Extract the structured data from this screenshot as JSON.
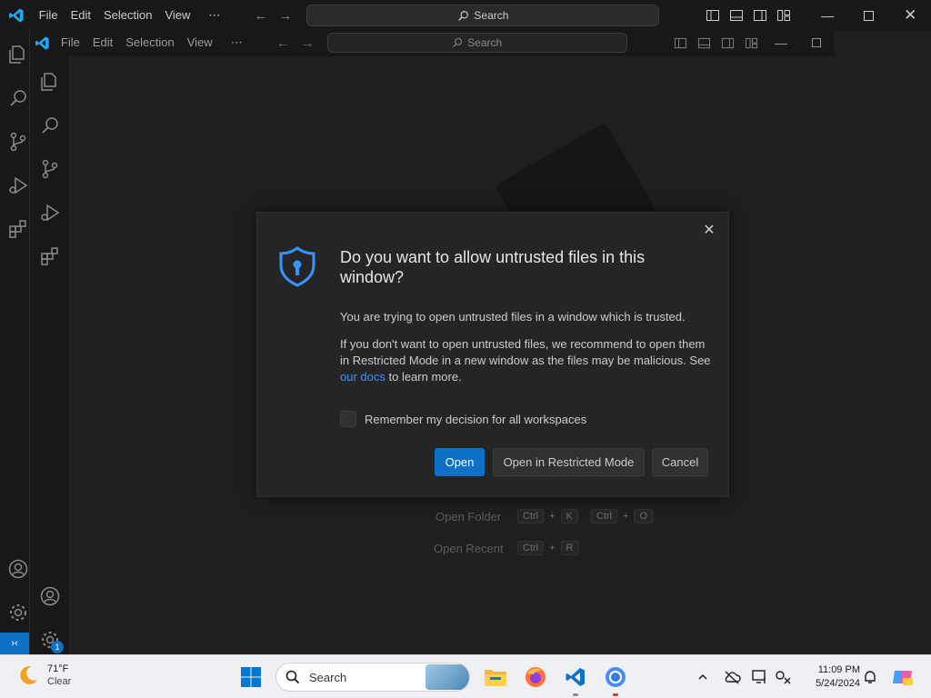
{
  "back_window": {
    "menu": [
      "File",
      "Edit",
      "Selection",
      "View",
      "⋯"
    ],
    "search_label": "Search"
  },
  "front_window": {
    "menu": [
      "File",
      "Edit",
      "Selection",
      "View",
      "⋯"
    ],
    "search_label": "Search"
  },
  "background_hints": {
    "open_folder": {
      "label": "Open Folder",
      "keys1": [
        "Ctrl",
        "K"
      ],
      "keys2": [
        "Ctrl",
        "O"
      ]
    },
    "open_recent": {
      "label": "Open Recent",
      "keys": [
        "Ctrl",
        "R"
      ]
    }
  },
  "dialog": {
    "title": "Do you want to allow untrusted files in this window?",
    "paragraph1": "You are trying to open untrusted files in a window which is trusted.",
    "paragraph2_before": "If you don't want to open untrusted files, we recommend to open them in Restricted Mode in a new window as the files may be malicious. See ",
    "paragraph2_link": "our docs",
    "paragraph2_after": " to learn more.",
    "checkbox_label": "Remember my decision for all workspaces",
    "buttons": {
      "open": "Open",
      "restricted": "Open in Restricted Mode",
      "cancel": "Cancel"
    },
    "close_glyph": "✕"
  },
  "taskbar": {
    "weather": {
      "temp": "71°F",
      "condition": "Clear"
    },
    "search_label": "Search",
    "clock": {
      "time": "11:09 PM",
      "date": "5/24/2024"
    }
  },
  "badges": {
    "accounts_badge": "1"
  },
  "colors": {
    "accent": "#0e71c7",
    "link": "#3794ff",
    "vscode_blue": "#23a9f2"
  }
}
